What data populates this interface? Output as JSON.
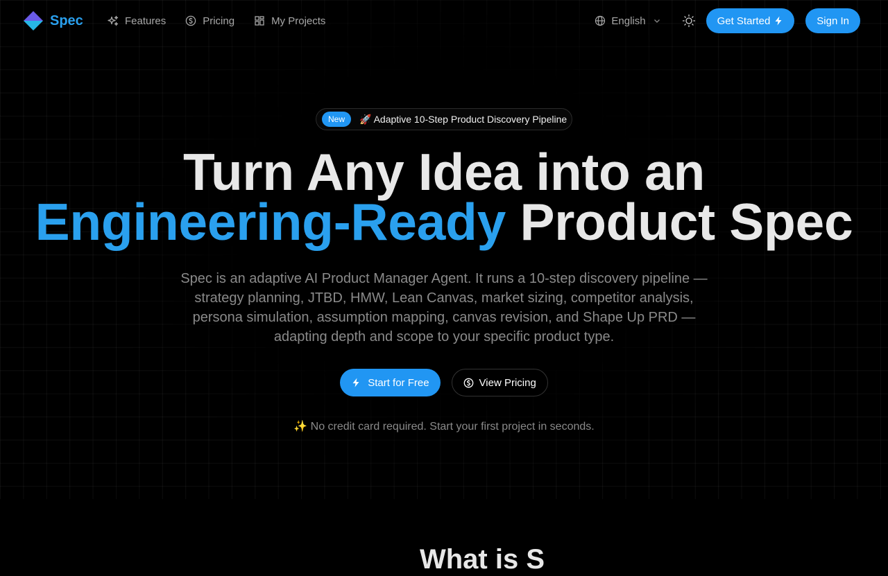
{
  "brand": {
    "name": "Spec",
    "color": "#2aa0ee"
  },
  "nav": {
    "links": [
      {
        "label": "Features",
        "icon": "sparkles-icon"
      },
      {
        "label": "Pricing",
        "icon": "dollar-circle-icon"
      },
      {
        "label": "My Projects",
        "icon": "grid-icon"
      }
    ],
    "language": "English",
    "get_started": "Get Started",
    "sign_in": "Sign In"
  },
  "badge": {
    "tag": "New",
    "text": "🚀 Adaptive 10-Step Product Discovery Pipeline"
  },
  "hero": {
    "line1": "Turn Any Idea into an",
    "accent": "Engineering-Ready",
    "line2_rest": " Product Spec",
    "subtitle": "Spec is an adaptive AI Product Manager Agent. It runs a 10-step discovery pipeline — strategy planning, JTBD, HMW, Lean Canvas, market sizing, competitor analysis, persona simulation, assumption mapping, canvas revision, and Shape Up PRD — adapting depth and scope to your specific product type."
  },
  "cta": {
    "primary": "Start for Free",
    "secondary": "View Pricing"
  },
  "note": "✨ No credit card required. Start your first project in seconds.",
  "section": {
    "title": "What is S"
  },
  "colors": {
    "accent": "#2196f3",
    "background": "#000000"
  }
}
